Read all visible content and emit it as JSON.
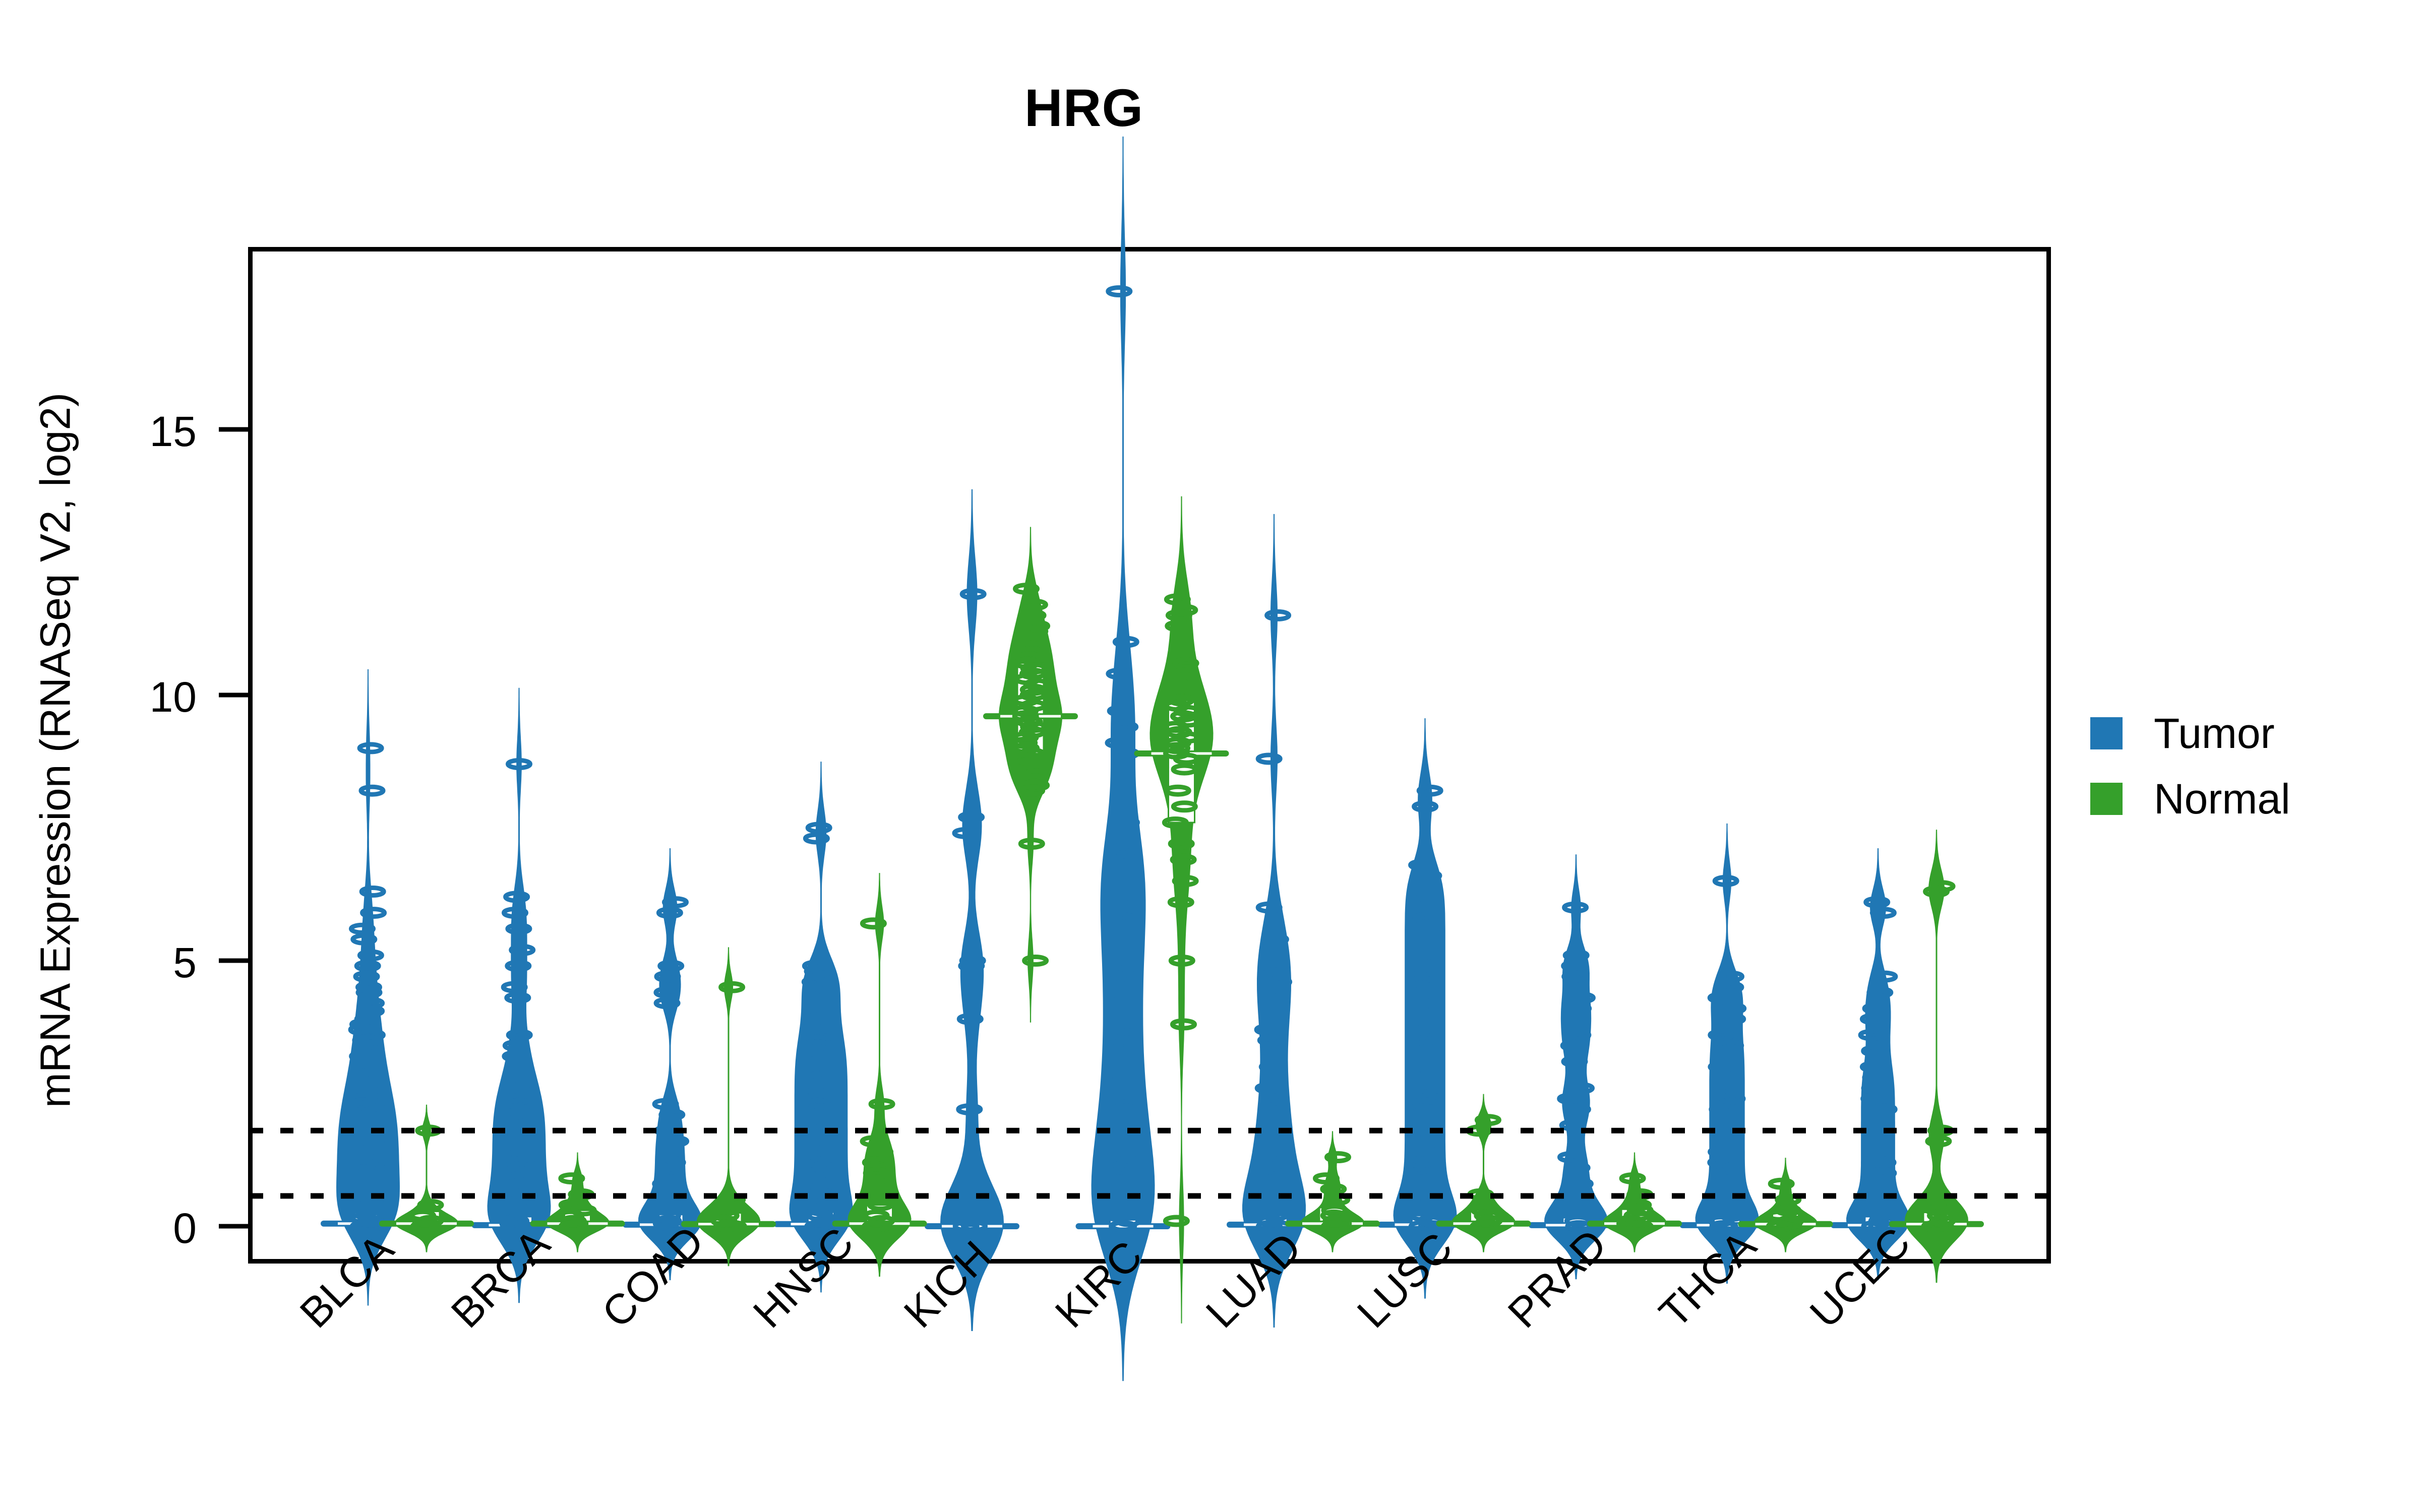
{
  "chart_data": {
    "type": "violin",
    "title": "HRG",
    "xlabel": "",
    "ylabel": "mRNA Expression (RNASeq V2, log2)",
    "ylim": [
      -1.4,
      18.7
    ],
    "yticks": [
      0,
      5,
      10,
      15
    ],
    "ytick_labels": [
      "0",
      "5",
      "10",
      "15"
    ],
    "grid": false,
    "legend": {
      "position": "right",
      "entries": [
        {
          "label": "Tumor",
          "color": "#2077b4"
        },
        {
          "label": "Normal",
          "color": "#35a02b"
        }
      ]
    },
    "threshold_lines": {
      "style": "dotted",
      "color": "#000000",
      "values": [
        1.8,
        0.57
      ]
    },
    "categories": [
      "BLCA",
      "BRCA",
      "COAD",
      "HNSC",
      "KICH",
      "KIRC",
      "LUAD",
      "LUSC",
      "PRAD",
      "THCA",
      "UCEC"
    ],
    "series": [
      {
        "name": "Tumor",
        "color": "#2077b4",
        "groups": [
          {
            "category": "BLCA",
            "median": 0.05,
            "q1": 0.0,
            "q3": 0.3,
            "min": -0.05,
            "max": 9.0,
            "points": [
              9.0,
              8.2,
              6.3,
              5.9,
              5.6,
              5.4,
              5.1,
              4.9,
              4.7,
              4.5,
              4.4,
              4.2,
              4.05,
              3.9,
              3.8,
              3.7,
              3.6,
              3.5,
              3.4,
              3.3,
              3.2,
              3.1,
              3.0,
              2.9,
              2.85,
              2.8,
              2.7,
              2.6,
              2.55,
              2.5,
              2.45,
              2.4,
              2.3,
              2.25,
              2.2,
              2.15,
              2.1,
              2.05,
              2.0,
              1.95,
              1.9,
              1.85,
              1.8,
              1.75,
              1.7,
              1.65,
              1.6,
              1.55,
              1.5,
              1.45,
              1.4,
              1.35,
              1.3,
              1.25,
              1.2,
              1.15,
              1.1,
              1.05,
              1.0,
              0.95,
              0.9,
              0.85,
              0.8,
              0.75,
              0.7,
              0.65,
              0.6,
              0.55,
              0.5,
              0.45,
              0.4,
              0.35,
              0.3,
              0.25,
              0.2,
              0.15,
              0.1,
              0.05,
              0.0,
              0.0,
              0.0,
              0.0
            ]
          },
          {
            "category": "BRCA",
            "median": 0.02,
            "q1": 0.0,
            "q3": 0.18,
            "min": -0.05,
            "max": 8.7,
            "points": [
              8.7,
              6.2,
              5.9,
              5.6,
              5.2,
              4.9,
              4.5,
              4.3,
              3.6,
              3.4,
              3.2,
              2.9,
              2.7,
              2.6,
              2.5,
              2.4,
              2.3,
              2.2,
              2.1,
              2.0,
              1.9,
              1.8,
              1.7,
              1.6,
              1.5,
              1.4,
              1.3,
              1.2,
              1.1,
              1.0,
              0.9,
              0.8,
              0.7,
              0.6,
              0.5,
              0.4,
              0.3,
              0.2,
              0.1,
              0.05,
              0.0,
              0.0,
              0.0
            ]
          },
          {
            "category": "COAD",
            "median": 0.03,
            "q1": 0.0,
            "q3": 0.22,
            "min": -0.05,
            "max": 6.1,
            "points": [
              6.1,
              5.9,
              4.9,
              4.7,
              4.4,
              4.2,
              2.3,
              2.1,
              1.8,
              1.6,
              1.4,
              1.2,
              1.0,
              0.8,
              0.6,
              0.4,
              0.2,
              0.1,
              0.05,
              0.0,
              0.0
            ]
          },
          {
            "category": "HNSC",
            "median": 0.04,
            "q1": 0.0,
            "q3": 0.28,
            "min": -0.05,
            "max": 7.5,
            "points": [
              7.5,
              7.3,
              4.9,
              4.8,
              4.7,
              4.6,
              4.5,
              4.4,
              4.2,
              4.0,
              3.9,
              3.8,
              3.6,
              3.5,
              3.4,
              3.3,
              3.2,
              3.1,
              3.0,
              2.9,
              2.8,
              2.7,
              2.6,
              2.5,
              2.4,
              2.3,
              2.2,
              2.1,
              2.0,
              1.9,
              1.8,
              1.7,
              1.6,
              1.5,
              1.4,
              1.3,
              1.2,
              1.1,
              1.0,
              0.9,
              0.8,
              0.7,
              0.6,
              0.5,
              0.4,
              0.3,
              0.2,
              0.1,
              0.05,
              0.0,
              0.0
            ]
          },
          {
            "category": "KICH",
            "median": 0.0,
            "q1": 0.0,
            "q3": 0.06,
            "min": -0.05,
            "max": 11.9,
            "points": [
              11.9,
              7.7,
              7.4,
              5.0,
              4.9,
              3.9,
              2.2,
              0.8,
              0.1,
              0.0,
              0.0
            ]
          },
          {
            "category": "KIRC",
            "median": 0.0,
            "q1": 0.0,
            "q3": 0.12,
            "min": -0.05,
            "max": 17.6,
            "points": [
              17.6,
              11.0,
              10.4,
              9.7,
              9.4,
              9.1,
              8.9,
              7.6,
              7.3,
              7.1,
              6.9,
              6.6,
              6.4,
              6.2,
              6.0,
              5.8,
              5.5,
              5.2,
              4.9,
              4.6,
              4.3,
              4.0,
              3.7,
              3.4,
              3.1,
              2.8,
              2.5,
              2.2,
              2.0,
              1.8,
              1.6,
              1.4,
              1.2,
              1.0,
              0.8,
              0.6,
              0.4,
              0.2,
              0.1,
              0.0,
              0.0
            ]
          },
          {
            "category": "LUAD",
            "median": 0.03,
            "q1": 0.0,
            "q3": 0.2,
            "min": -0.05,
            "max": 11.5,
            "points": [
              11.5,
              8.8,
              6.0,
              5.4,
              5.2,
              4.9,
              4.6,
              4.4,
              4.2,
              3.7,
              3.5,
              3.0,
              2.6,
              2.3,
              2.0,
              1.7,
              1.5,
              1.2,
              1.0,
              0.8,
              0.6,
              0.4,
              0.2,
              0.1,
              0.0,
              0.0
            ]
          },
          {
            "category": "LUSC",
            "median": 0.03,
            "q1": 0.0,
            "q3": 0.2,
            "min": -0.05,
            "max": 8.2,
            "points": [
              8.2,
              7.9,
              6.8,
              6.6,
              6.4,
              6.2,
              6.0,
              5.8,
              5.6,
              5.4,
              5.2,
              5.0,
              4.8,
              4.6,
              4.4,
              4.2,
              4.0,
              3.8,
              3.6,
              3.4,
              3.2,
              3.0,
              2.8,
              2.6,
              2.4,
              2.2,
              2.0,
              1.8,
              1.6,
              1.4,
              1.2,
              1.0,
              0.8,
              0.6,
              0.4,
              0.2,
              0.1,
              0.0,
              0.0
            ]
          },
          {
            "category": "PRAD",
            "median": 0.02,
            "q1": 0.0,
            "q3": 0.16,
            "min": -0.05,
            "max": 6.0,
            "points": [
              6.0,
              5.1,
              4.9,
              4.7,
              4.3,
              4.1,
              3.9,
              3.6,
              3.4,
              3.1,
              2.6,
              2.4,
              2.2,
              1.9,
              1.3,
              1.1,
              0.8,
              0.5,
              0.3,
              0.1,
              0.0,
              0.0
            ]
          },
          {
            "category": "THCA",
            "median": 0.02,
            "q1": 0.0,
            "q3": 0.16,
            "min": -0.05,
            "max": 6.5,
            "points": [
              6.5,
              4.7,
              4.5,
              4.3,
              4.1,
              3.9,
              3.6,
              3.4,
              3.2,
              3.0,
              2.8,
              2.6,
              2.4,
              2.2,
              2.0,
              1.8,
              1.6,
              1.4,
              1.2,
              1.0,
              0.8,
              0.6,
              0.4,
              0.2,
              0.1,
              0.0,
              0.0
            ]
          },
          {
            "category": "UCEC",
            "median": 0.02,
            "q1": 0.0,
            "q3": 0.18,
            "min": -0.05,
            "max": 6.1,
            "points": [
              6.1,
              5.9,
              4.7,
              4.4,
              4.1,
              3.9,
              3.6,
              3.3,
              3.0,
              2.8,
              2.6,
              2.4,
              2.2,
              2.0,
              1.8,
              1.6,
              1.4,
              1.2,
              1.0,
              0.8,
              0.6,
              0.4,
              0.2,
              0.1,
              0.0,
              0.0
            ]
          }
        ]
      },
      {
        "name": "Normal",
        "color": "#35a02b",
        "groups": [
          {
            "category": "BLCA",
            "median": 0.05,
            "q1": 0.0,
            "q3": 0.28,
            "min": -0.05,
            "max": 1.8,
            "points": [
              1.8,
              0.4,
              0.2,
              0.1,
              0.05,
              0.0,
              0.0
            ]
          },
          {
            "category": "BRCA",
            "median": 0.05,
            "q1": 0.0,
            "q3": 0.3,
            "min": -0.05,
            "max": 0.9,
            "points": [
              0.9,
              0.6,
              0.4,
              0.3,
              0.2,
              0.1,
              0.05,
              0.0,
              0.0
            ]
          },
          {
            "category": "COAD",
            "median": 0.04,
            "q1": 0.0,
            "q3": 0.25,
            "min": -0.05,
            "max": 4.5,
            "points": [
              4.5,
              0.5,
              0.3,
              0.2,
              0.1,
              0.0,
              0.0
            ]
          },
          {
            "category": "HNSC",
            "median": 0.05,
            "q1": 0.0,
            "q3": 0.4,
            "min": -0.05,
            "max": 5.7,
            "points": [
              5.7,
              2.3,
              1.6,
              1.4,
              1.2,
              1.0,
              0.8,
              0.6,
              0.4,
              0.2,
              0.1,
              0.0,
              0.0
            ]
          },
          {
            "category": "KICH",
            "median": 9.6,
            "q1": 8.9,
            "q3": 10.6,
            "min": 5.0,
            "max": 12.0,
            "points": [
              12.0,
              11.7,
              11.5,
              11.3,
              11.2,
              11.0,
              10.9,
              10.8,
              10.7,
              10.6,
              10.5,
              10.4,
              10.3,
              10.2,
              10.1,
              10.0,
              9.9,
              9.8,
              9.7,
              9.6,
              9.5,
              9.4,
              9.3,
              9.2,
              9.1,
              9.0,
              8.9,
              8.8,
              8.7,
              8.6,
              8.5,
              8.4,
              8.3,
              8.2,
              7.2,
              5.0
            ]
          },
          {
            "category": "KIRC",
            "median": 8.9,
            "q1": 7.6,
            "q3": 9.9,
            "min": 0.1,
            "max": 11.8,
            "points": [
              11.8,
              11.6,
              11.5,
              11.3,
              10.6,
              10.4,
              10.2,
              10.0,
              9.9,
              9.8,
              9.7,
              9.6,
              9.5,
              9.4,
              9.3,
              9.2,
              9.1,
              9.0,
              8.9,
              8.8,
              8.6,
              8.2,
              7.9,
              7.6,
              7.2,
              6.9,
              6.5,
              6.1,
              5.0,
              3.8,
              0.1
            ]
          },
          {
            "category": "LUAD",
            "median": 0.05,
            "q1": 0.0,
            "q3": 0.35,
            "min": -0.05,
            "max": 1.3,
            "points": [
              1.3,
              0.9,
              0.7,
              0.5,
              0.3,
              0.2,
              0.1,
              0.05,
              0.0,
              0.0
            ]
          },
          {
            "category": "LUSC",
            "median": 0.05,
            "q1": 0.0,
            "q3": 0.3,
            "min": -0.05,
            "max": 2.0,
            "points": [
              2.0,
              1.8,
              0.6,
              0.4,
              0.3,
              0.2,
              0.1,
              0.0,
              0.0
            ]
          },
          {
            "category": "PRAD",
            "median": 0.05,
            "q1": 0.0,
            "q3": 0.32,
            "min": -0.05,
            "max": 0.9,
            "points": [
              0.9,
              0.6,
              0.4,
              0.3,
              0.2,
              0.1,
              0.05,
              0.0,
              0.0
            ]
          },
          {
            "category": "THCA",
            "median": 0.04,
            "q1": 0.0,
            "q3": 0.26,
            "min": -0.05,
            "max": 0.8,
            "points": [
              0.8,
              0.5,
              0.3,
              0.2,
              0.1,
              0.05,
              0.0,
              0.0
            ]
          },
          {
            "category": "UCEC",
            "median": 0.04,
            "q1": 0.0,
            "q3": 0.26,
            "min": -0.05,
            "max": 6.4,
            "points": [
              6.4,
              6.3,
              1.8,
              1.6,
              0.5,
              0.3,
              0.2,
              0.1,
              0.0,
              0.0
            ]
          }
        ]
      }
    ]
  }
}
